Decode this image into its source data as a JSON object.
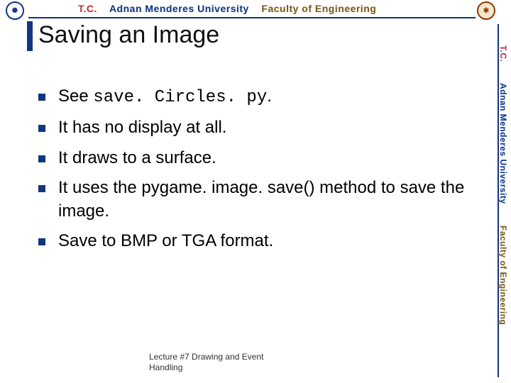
{
  "banner": {
    "tc": "T.C.",
    "university": "Adnan Menderes University",
    "faculty": "Faculty of Engineering"
  },
  "title": "Saving an Image",
  "bullets": [
    {
      "prefix": "See ",
      "code": "save. Circles. py",
      "suffix": "."
    },
    {
      "text": "It has no display at all."
    },
    {
      "text": "It draws to a surface."
    },
    {
      "text": "It uses the pygame. image. save() method to save the image."
    },
    {
      "text": "Save to BMP or TGA format."
    }
  ],
  "footer": {
    "line1": "Lecture #7 Drawing and Event",
    "line2": "Handling"
  }
}
